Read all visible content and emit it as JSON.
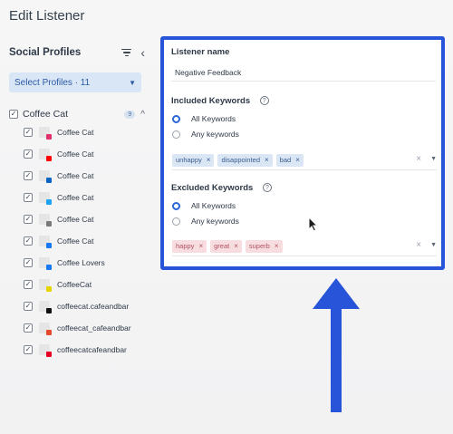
{
  "header": {
    "title": "Edit Listener"
  },
  "sidebar": {
    "title": "Social Profiles",
    "select_label": "Select Profiles · 11",
    "group": {
      "name": "Coffee Cat",
      "count": "9",
      "checked": "✓"
    },
    "profiles": [
      {
        "name": "Coffee Cat",
        "network": "instagram",
        "color": "#e1306c",
        "checked": "✓"
      },
      {
        "name": "Coffee Cat",
        "network": "youtube",
        "color": "#ff0000",
        "checked": "✓"
      },
      {
        "name": "Coffee Cat",
        "network": "linkedin",
        "color": "#0a66c2",
        "checked": "✓"
      },
      {
        "name": "Coffee Cat",
        "network": "twitter",
        "color": "#1da1f2",
        "checked": "✓"
      },
      {
        "name": "Coffee Cat",
        "network": "business",
        "color": "#7a7a7a",
        "checked": "✓"
      },
      {
        "name": "Coffee Cat",
        "network": "facebook",
        "color": "#1877f2",
        "checked": "✓"
      },
      {
        "name": "Coffee Lovers",
        "network": "facebook",
        "color": "#1877f2",
        "checked": "✓"
      },
      {
        "name": "CoffeeCat",
        "network": "snapchat",
        "color": "#e6d400",
        "checked": "✓"
      },
      {
        "name": "coffeecat.cafeandbar",
        "network": "tiktok",
        "color": "#111111",
        "checked": "✓"
      },
      {
        "name": "coffeecat_cafeandbar",
        "network": "other",
        "color": "#e54b2a",
        "checked": "✓"
      },
      {
        "name": "coffeecatcafeandbar",
        "network": "pinterest",
        "color": "#e60023",
        "checked": "✓"
      }
    ]
  },
  "panel": {
    "name_label": "Listener name",
    "name_value": "Negative Feedback",
    "included": {
      "label": "Included Keywords",
      "help": "?",
      "option_all": "All Keywords",
      "option_any": "Any keywords",
      "selected": "all",
      "chips": [
        "unhappy",
        "disappointed",
        "bad"
      ]
    },
    "excluded": {
      "label": "Excluded Keywords",
      "help": "?",
      "option_all": "All Keywords",
      "option_any": "Any keywords",
      "selected": "all",
      "chips": [
        "happy",
        "great",
        "superb"
      ]
    },
    "chip_remove": "×",
    "clear_icon": "×",
    "dropdown_icon": "▼"
  },
  "colors": {
    "accent": "#2754d8",
    "radio": "#2b66d9",
    "include_chip_bg": "#dbe6f5",
    "exclude_chip_bg": "#f7dde0"
  },
  "icons": {
    "filter": "filter-icon",
    "collapse": "chevron-left-icon",
    "caret": "▼",
    "group_toggle": "^"
  }
}
